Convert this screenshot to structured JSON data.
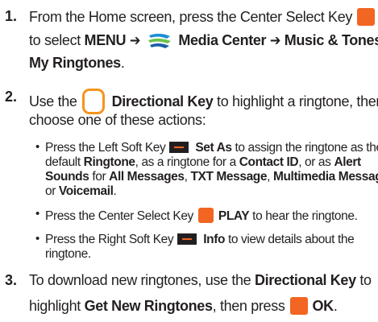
{
  "steps": [
    {
      "number": "1.",
      "line1_pre": "From the Home screen, press the Center Select Key",
      "line2_pre": "to select",
      "menu": "MENU",
      "arrow": "➔",
      "media_center": "Media Center",
      "music_tones": "Music & Tones",
      "line3": "My Ringtones",
      "period": "."
    },
    {
      "number": "2.",
      "line1_pre": "Use the",
      "directional_key": "Directional Key",
      "line1_post": "to highlight a ringtone, then",
      "line2": "choose one of these actions:"
    },
    {
      "number": "3.",
      "line1_pre": "To download new ringtones, use the",
      "directional_key": "Directional Key",
      "line1_post": "to",
      "line2_pre": "highlight",
      "get_new": "Get New Ringtones",
      "line2_mid": ", then press",
      "ok": "OK",
      "period": "."
    }
  ],
  "bullets": [
    {
      "bullet": "•",
      "l1_pre": "Press the Left Soft Key",
      "set_as": "Set As",
      "l1_post": "to assign the ringtone as the",
      "l2_pre": "default",
      "ringtone": "Ringtone",
      "l2_mid": ", as a ringtone for a",
      "contact_id": "Contact ID",
      "l2_post": ", or as",
      "alert": "Alert",
      "sounds": "Sounds",
      "for": "for",
      "all_messages": "All Messages",
      "comma": ",",
      "txt_message": "TXT Message",
      "multimedia": "Multimedia Message",
      "or": "or",
      "voicemail": "Voicemail",
      "period": "."
    },
    {
      "bullet": "•",
      "l1_pre": "Press the Center Select Key",
      "play": "PLAY",
      "l1_post": "to hear the ringtone."
    },
    {
      "bullet": "•",
      "l1_pre": "Press the Right Soft Key",
      "info": "Info",
      "l1_post": "to view details about the",
      "l2": "ringtone."
    }
  ],
  "colors": {
    "key_orange": "#f26522",
    "text": "#231f20"
  },
  "icons": [
    "center-select-key-icon",
    "media-center-icon",
    "directional-key-icon",
    "left-soft-key-icon",
    "right-soft-key-icon"
  ]
}
